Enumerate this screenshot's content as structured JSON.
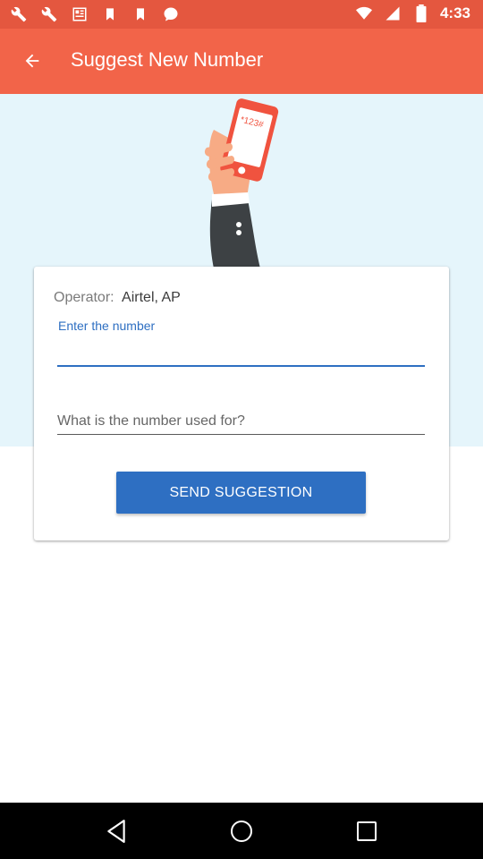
{
  "status_bar": {
    "time": "4:33",
    "left_icons": [
      "wrench-icon",
      "wrench-icon",
      "news-icon",
      "bookmark-icon",
      "bookmark-icon",
      "chat-icon"
    ],
    "right_icons": [
      "wifi-icon",
      "signal-icon",
      "battery-icon"
    ]
  },
  "app_bar": {
    "title": "Suggest New Number",
    "back_icon": "arrow-left-icon"
  },
  "hero": {
    "phone_text": "*123#"
  },
  "form": {
    "operator_label": "Operator:",
    "operator_value": "Airtel, AP",
    "number_label": "Enter the number",
    "number_value": "",
    "usage_placeholder": "What is the number used for?",
    "send_label": "SEND SUGGESTION"
  },
  "nav_bar": {
    "buttons": [
      "back-icon",
      "home-icon",
      "recents-icon"
    ]
  },
  "colors": {
    "status_bar": "#e4573f",
    "app_bar": "#f26449",
    "hero_bg": "#e5f5fb",
    "accent": "#2e6fc2"
  }
}
